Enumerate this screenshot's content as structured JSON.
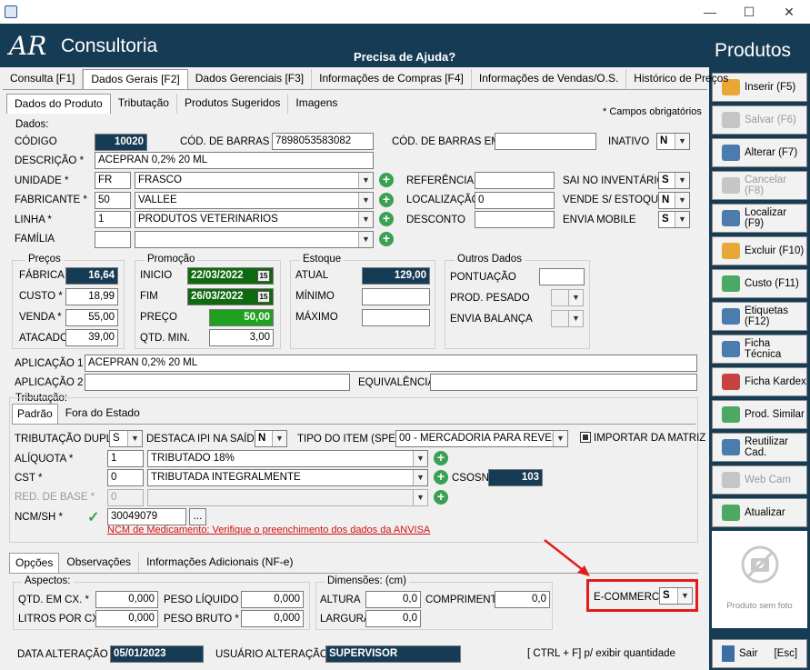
{
  "window": {
    "minimize": "—",
    "maximize": "☐",
    "close": "✕"
  },
  "header": {
    "brand": "Consultoria",
    "logo_mark": "AR",
    "help": "Precisa de Ajuda?"
  },
  "panel": {
    "title": "Produtos",
    "photo_caption": "Produto sem foto",
    "buttons": [
      {
        "label": "Inserir (F5)",
        "icon": "plus-cross-icon"
      },
      {
        "label": "Salvar (F6)",
        "icon": "save-icon"
      },
      {
        "label": "Alterar (F7)",
        "icon": "edit-icon"
      },
      {
        "label": "Cancelar (F8)",
        "icon": "cancel-icon"
      },
      {
        "label": "Localizar (F9)",
        "icon": "search-icon"
      },
      {
        "label": "Excluir (F10)",
        "icon": "delete-icon"
      },
      {
        "label": "Custo (F11)",
        "icon": "money-icon"
      },
      {
        "label": "Etiquetas (F12)",
        "icon": "labels-icon"
      },
      {
        "label": "Ficha Técnica",
        "icon": "datasheet-icon"
      },
      {
        "label": "Ficha Kardex",
        "icon": "kardex-icon"
      },
      {
        "label": "Prod. Similar",
        "icon": "cart-icon"
      },
      {
        "label": "Reutilizar Cad.",
        "icon": "reuse-icon"
      },
      {
        "label": "Web Cam",
        "icon": "webcam-icon"
      },
      {
        "label": "Atualizar",
        "icon": "refresh-icon"
      }
    ],
    "exit": {
      "label": "Sair",
      "shortcut": "[Esc]"
    }
  },
  "tabs_main": [
    "Consulta [F1]",
    "Dados Gerais [F2]",
    "Dados Gerenciais [F3]",
    "Informações de Compras [F4]",
    "Informações de Vendas/O.S.",
    "Histórico de Preços"
  ],
  "tabs_sub": [
    "Dados do Produto",
    "Tributação",
    "Produtos Sugeridos",
    "Imagens"
  ],
  "required_note": "* Campos obrigatórios",
  "dados": {
    "legend": "Dados:",
    "codigo_lbl": "CÓDIGO",
    "codigo": "10020",
    "cod_barras_lbl": "CÓD. DE BARRAS *",
    "cod_barras": "7898053583082",
    "cod_barras_emb_lbl": "CÓD. DE BARRAS EMB",
    "cod_barras_emb": "",
    "inativo_lbl": "INATIVO",
    "inativo": "N",
    "descricao_lbl": "DESCRIÇÃO *",
    "descricao": "ACEPRAN 0,2% 20 ML",
    "unidade_lbl": "UNIDADE *",
    "unidade_cod": "FR",
    "unidade": "FRASCO",
    "fabricante_lbl": "FABRICANTE *",
    "fabricante_cod": "50",
    "fabricante": "VALLEE",
    "linha_lbl": "LINHA *",
    "linha_cod": "1",
    "linha": "PRODUTOS VETERINARIOS",
    "familia_lbl": "FAMÍLIA",
    "familia_cod": "",
    "familia": "",
    "referencia_lbl": "REFERÊNCIA",
    "referencia": "",
    "localizacao_lbl": "LOCALIZAÇÃO",
    "localizacao": "0",
    "desconto_lbl": "DESCONTO",
    "desconto": "",
    "sai_inv_lbl": "SAI NO INVENTÁRIO",
    "sai_inv": "S",
    "vende_lbl": "VENDE S/ ESTOQUE",
    "vende": "N",
    "mobile_lbl": "ENVIA MOBILE",
    "mobile": "S"
  },
  "precos": {
    "legend": "Preços",
    "fabrica_lbl": "FÁBRICA",
    "fabrica": "16,64",
    "custo_lbl": "CUSTO *",
    "custo": "18,99",
    "venda_lbl": "VENDA *",
    "venda": "55,00",
    "atacado_lbl": "ATACADO",
    "atacado": "39,00"
  },
  "promocao": {
    "legend": "Promoção",
    "inicio_lbl": "INICIO",
    "inicio": "22/03/2022",
    "fim_lbl": "FIM",
    "fim": "26/03/2022",
    "preco_lbl": "PREÇO",
    "preco": "50,00",
    "qtd_lbl": "QTD. MIN.",
    "qtd": "3,00",
    "cal": "15"
  },
  "estoque": {
    "legend": "Estoque",
    "atual_lbl": "ATUAL",
    "atual": "129,00",
    "minimo_lbl": "MÍNIMO",
    "minimo": "",
    "maximo_lbl": "MÁXIMO",
    "maximo": ""
  },
  "outros": {
    "legend": "Outros Dados",
    "pontuacao_lbl": "PONTUAÇÃO",
    "pontuacao": "",
    "pesado_lbl": "PROD. PESADO",
    "pesado": "",
    "balanca_lbl": "ENVIA BALANÇA",
    "balanca": ""
  },
  "aplicacao": {
    "a1_lbl": "APLICAÇÃO 1",
    "a1": "ACEPRAN 0,2% 20 ML",
    "a2_lbl": "APLICAÇÃO 2",
    "a2": "",
    "equiv_lbl": "EQUIVALÊNCIA",
    "equiv": ""
  },
  "tributacao": {
    "legend": "Tributação:",
    "tabs": [
      "Padrão",
      "Fora do Estado"
    ],
    "dupla_lbl": "TRIBUTAÇÃO DUPLA",
    "dupla": "S",
    "destaca_lbl": "DESTACA IPI NA SAÍDA",
    "destaca": "N",
    "tipo_lbl": "TIPO DO ITEM (SPED)",
    "tipo": "00 - MERCADORIA PARA REVENDA",
    "importar_lbl": "IMPORTAR DA MATRIZ",
    "aliquota_lbl": "ALÍQUOTA *",
    "aliquota_cod": "1",
    "aliquota": "TRIBUTADO 18%",
    "cst_lbl": "CST *",
    "cst_cod": "0",
    "cst": "TRIBUTADA INTEGRALMENTE",
    "csosn_lbl": "CSOSN",
    "csosn": "103",
    "red_lbl": "RED. DE BASE *",
    "red_cod": "0",
    "red": "",
    "ncm_lbl": "NCM/SH *",
    "ncm": "30049079",
    "ncm_btn": "...",
    "ncm_warn": "NCM de Medicamento: Verifique o preenchimento dos dados da ANVISA"
  },
  "tabs_bottom": [
    "Opções",
    "Observações",
    "Informações Adicionais (NF-e)"
  ],
  "aspectos": {
    "legend": "Aspectos:",
    "qtd_cx_lbl": "QTD. EM CX. *",
    "qtd_cx": "0,000",
    "litros_lbl": "LITROS POR CX.",
    "litros": "0,000",
    "peso_liq_lbl": "PESO LÍQUIDO *",
    "peso_liq": "0,000",
    "peso_bruto_lbl": "PESO BRUTO *",
    "peso_bruto": "0,000"
  },
  "dimensoes": {
    "legend": "Dimensões: (cm)",
    "altura_lbl": "ALTURA",
    "altura": "0,0",
    "largura_lbl": "LARGURA",
    "largura": "0,0",
    "comprimento_lbl": "COMPRIMENTO",
    "comprimento": "0,0"
  },
  "ecommerce": {
    "label": "E-COMMERCE",
    "value": "S",
    "highlight": "#e31b1b"
  },
  "footer": {
    "data_lbl": "DATA ALTERAÇÃO",
    "data": "05/01/2023",
    "usuario_lbl": "USUÁRIO ALTERAÇÃO",
    "usuario": "SUPERVISOR",
    "hint": "[ CTRL + F] p/ exibir quantidade"
  }
}
